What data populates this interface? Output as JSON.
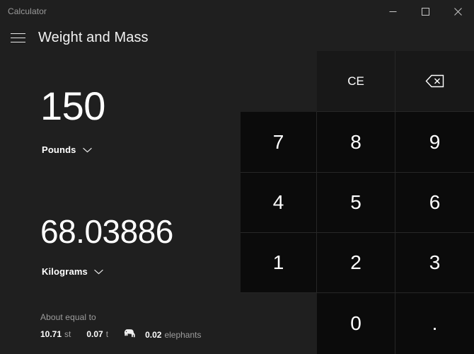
{
  "window": {
    "app_title": "Calculator",
    "controls": [
      {
        "name": "minimize",
        "label": "Minimize"
      },
      {
        "name": "maximize",
        "label": "Maximize"
      },
      {
        "name": "close",
        "label": "Close"
      }
    ]
  },
  "header": {
    "menu_icon": "hamburger-icon",
    "page_title": "Weight and Mass"
  },
  "converter": {
    "input": {
      "value": "150",
      "unit": "Pounds",
      "chevron": "chevron-down-icon"
    },
    "output": {
      "value": "68.03886",
      "unit": "Kilograms",
      "chevron": "chevron-down-icon"
    },
    "about_equal": {
      "label": "About equal to",
      "items": [
        {
          "value": "10.71",
          "unit": "st",
          "icon": ""
        },
        {
          "value": "0.07",
          "unit": "t",
          "icon": ""
        },
        {
          "value": "0.02",
          "unit": "elephants",
          "icon": "elephant-icon"
        }
      ]
    }
  },
  "keypad": {
    "clear_entry": "CE",
    "backspace_icon": "backspace-icon",
    "keys": [
      {
        "label": "7",
        "name": "key-7"
      },
      {
        "label": "8",
        "name": "key-8"
      },
      {
        "label": "9",
        "name": "key-9"
      },
      {
        "label": "4",
        "name": "key-4"
      },
      {
        "label": "5",
        "name": "key-5"
      },
      {
        "label": "6",
        "name": "key-6"
      },
      {
        "label": "1",
        "name": "key-1"
      },
      {
        "label": "2",
        "name": "key-2"
      },
      {
        "label": "3",
        "name": "key-3"
      },
      {
        "label": "0",
        "name": "key-0"
      },
      {
        "label": ".",
        "name": "key-decimal"
      }
    ]
  },
  "colors": {
    "background": "#1f1f1f",
    "number_key": "#0b0b0b",
    "command_key": "#181818",
    "key_border": "#272727",
    "text_primary": "#ffffff",
    "text_secondary": "#9d9d9d"
  }
}
